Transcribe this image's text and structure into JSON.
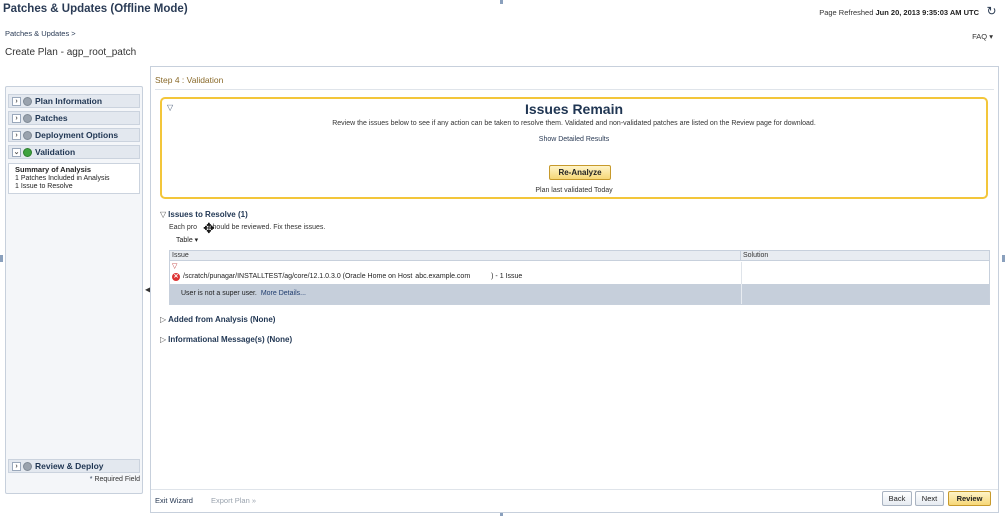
{
  "header": {
    "title": "Patches & Updates (Offline Mode)",
    "refresh_label": "Page Refreshed",
    "refresh_time": "Jun 20, 2013 9:35:03 AM UTC",
    "refresh_icon": "refresh-icon"
  },
  "breadcrumb": "Patches & Updates >",
  "faq": "FAQ ▾",
  "subtitle": "Create Plan - agp_root_patch",
  "sidebar": {
    "items": [
      {
        "label": "Plan Information",
        "chevron": "›"
      },
      {
        "label": "Patches",
        "chevron": "›"
      },
      {
        "label": "Deployment Options",
        "chevron": "›"
      },
      {
        "label": "Validation",
        "chevron": "⌄"
      }
    ],
    "summary": {
      "title": "Summary of Analysis",
      "line1": "1  Patches Included in Analysis",
      "line2": "1  Issue to Resolve"
    },
    "bottom_item": {
      "label": "Review & Deploy",
      "chevron": "›"
    },
    "required_marker": "*",
    "required_text": "Required Field",
    "collapse_glyph": "◀"
  },
  "main": {
    "step_title": "Step 4 : Validation",
    "box": {
      "toggle": "▽",
      "title": "Issues Remain",
      "description": "Review the issues below to see if any action can be taken to resolve them. Validated and non-validated patches are listed on the Review page for download.",
      "link": "Show Detailed Results",
      "button": "Re-Analyze",
      "footer": "Plan last validated Today"
    },
    "issues_section": {
      "toggle": "▽",
      "title": "Issues to Resolve (1)",
      "desc_before": "Each pro",
      "desc_after": "should be reviewed. Fix these issues.",
      "table_menu": "Table ▾",
      "columns": [
        "Issue",
        "Solution"
      ],
      "row": {
        "toggle": "▽",
        "path": "/scratch/punagar/INSTALLTEST/ag/core/12.1.0.3.0 (Oracle Home on Host",
        "host": "abc.example.com",
        "count": ") - 1 Issue",
        "detail": "User is not a super user.",
        "detail_link": "More Details..."
      }
    },
    "added_section": {
      "toggle": "▷",
      "title": "Added from Analysis (None)"
    },
    "info_section": {
      "toggle": "▷",
      "title": "Informational Message(s) (None)"
    },
    "footer": {
      "exit_wizard": "Exit Wizard",
      "export_plan": "Export Plan »",
      "back": "Back",
      "next": "Next",
      "review": "Review"
    }
  }
}
